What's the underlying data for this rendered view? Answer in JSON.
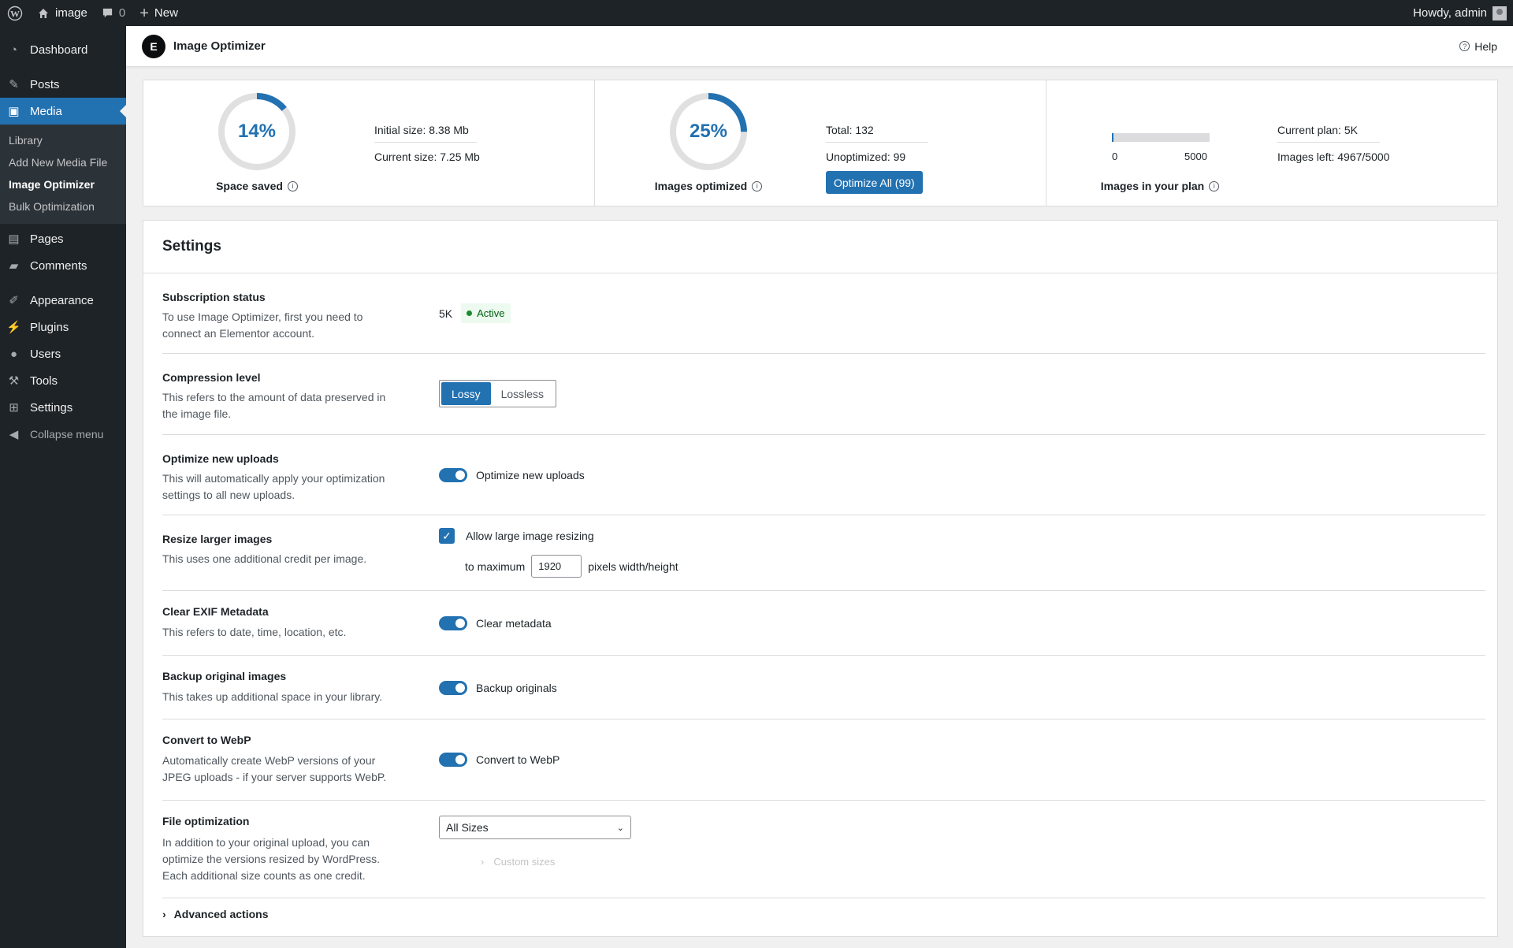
{
  "adminbar": {
    "site_name": "image",
    "comments_count": "0",
    "new_label": "New",
    "greeting": "Howdy, admin"
  },
  "sidebar": {
    "items": [
      {
        "label": "Dashboard",
        "icon": "dashboard-icon"
      },
      {
        "label": "Posts",
        "icon": "pin-icon"
      },
      {
        "label": "Media",
        "icon": "media-icon"
      },
      {
        "label": "Pages",
        "icon": "pages-icon"
      },
      {
        "label": "Comments",
        "icon": "comments-icon"
      },
      {
        "label": "Appearance",
        "icon": "brush-icon"
      },
      {
        "label": "Plugins",
        "icon": "plugin-icon"
      },
      {
        "label": "Users",
        "icon": "users-icon"
      },
      {
        "label": "Tools",
        "icon": "wrench-icon"
      },
      {
        "label": "Settings",
        "icon": "settings-icon"
      }
    ],
    "submenu": [
      "Library",
      "Add New Media File",
      "Image Optimizer",
      "Bulk Optimization"
    ],
    "collapse_label": "Collapse menu"
  },
  "header": {
    "title": "Image Optimizer",
    "help_label": "Help"
  },
  "stats": {
    "space_saved": {
      "percent": "14%",
      "value": 0.14,
      "label": "Space saved",
      "initial": "Initial size: 8.38 Mb",
      "current": "Current size: 7.25 Mb"
    },
    "images_optimized": {
      "percent": "25%",
      "value": 0.25,
      "label": "Images optimized",
      "total": "Total: 132",
      "unoptimized": "Unoptimized: 99",
      "button": "Optimize All (99)"
    },
    "plan": {
      "label": "Images in your plan",
      "min": "0",
      "max": "5000",
      "used_fraction": 0.0066,
      "current_plan": "Current plan: 5K",
      "images_left": "Images left: 4967/5000"
    }
  },
  "settings": {
    "title": "Settings",
    "subscription": {
      "title": "Subscription status",
      "desc": "To use Image Optimizer, first you need to connect an Elementor account.",
      "plan": "5K",
      "status": "Active"
    },
    "compression": {
      "title": "Compression level",
      "desc": "This refers to the amount of data preserved in the image file.",
      "options": [
        "Lossy",
        "Lossless"
      ],
      "selected": "Lossy"
    },
    "optimize_uploads": {
      "title": "Optimize new uploads",
      "desc": "This will automatically apply your optimization settings to all new uploads.",
      "toggle_label": "Optimize new uploads",
      "on": true
    },
    "resize": {
      "title": "Resize larger images",
      "desc": "This uses one additional credit per image.",
      "checkbox_label": "Allow large image resizing",
      "checked": true,
      "prefix": "to maximum",
      "value": "1920",
      "suffix": "pixels width/height"
    },
    "exif": {
      "title": "Clear EXIF Metadata",
      "desc": "This refers to date, time, location, etc.",
      "toggle_label": "Clear metadata",
      "on": true
    },
    "backup": {
      "title": "Backup original images",
      "desc": "This takes up additional space in your library.",
      "toggle_label": "Backup originals",
      "on": true
    },
    "webp": {
      "title": "Convert to WebP",
      "desc": "Automatically create WebP versions of your JPEG uploads - if your server supports WebP.",
      "toggle_label": "Convert to WebP",
      "on": true
    },
    "file_opt": {
      "title": "File optimization",
      "desc": "In addition to your original upload, you can optimize the versions resized by WordPress. Each additional size counts as one credit.",
      "selected": "All Sizes",
      "custom_label": "Custom sizes"
    },
    "advanced": "Advanced actions"
  }
}
